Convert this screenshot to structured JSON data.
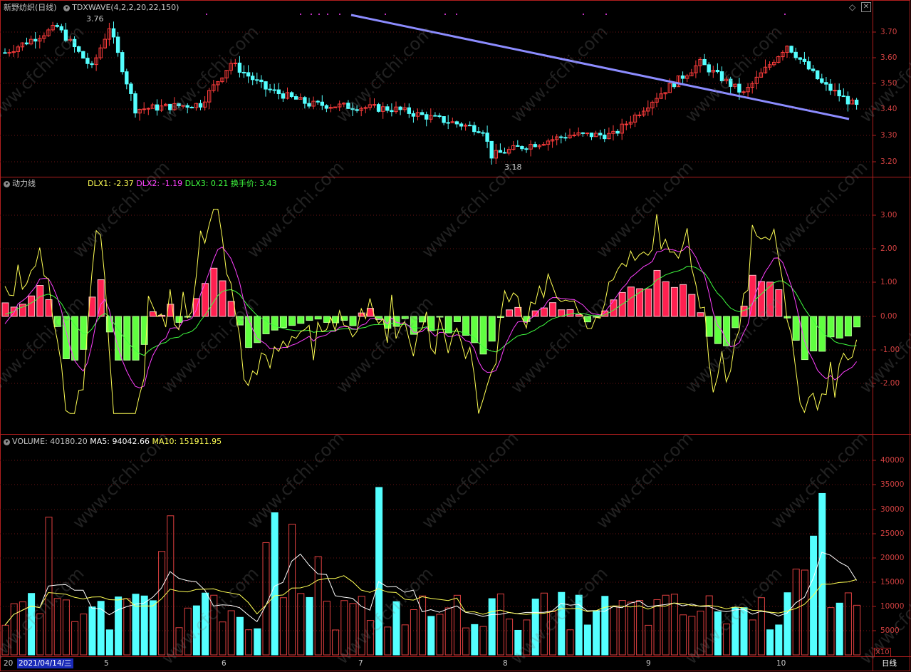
{
  "main": {
    "stock_name": "新野纺织",
    "period": "(日线)",
    "indicator": "TDXWAVE(4,2,2,20,22,150)",
    "high_label": "3.76",
    "low_label": "3.18",
    "yaxis": [
      "3.70",
      "3.60",
      "3.50",
      "3.40",
      "3.30",
      "3.20"
    ]
  },
  "dl": {
    "name": "动力线",
    "dlx1": "DLX1: -2.37",
    "dlx2": "DLX2: -1.19",
    "dlx3": "DLX3: 0.21",
    "hsj": "换手价: 3.43",
    "yaxis": [
      "3.00",
      "2.00",
      "1.00",
      "0.00",
      "-1.00",
      "-2.00"
    ]
  },
  "vol": {
    "volume": "VOLUME: 40180.20",
    "ma5": "MA5: 94042.66",
    "ma10": "MA10: 151911.95",
    "yaxis": [
      "40000",
      "35000",
      "30000",
      "25000",
      "20000",
      "15000",
      "10000",
      "5000"
    ],
    "unit": "X10"
  },
  "xaxis": {
    "prefix": "20",
    "cursor_date": "2021/04/14/三",
    "months": [
      "5",
      "6",
      "7",
      "8",
      "9",
      "10"
    ],
    "period_button": "日线"
  },
  "watermark": "www.cfchi.com",
  "colors": {
    "up": "#ff3c3c",
    "down": "#54ffff",
    "frame": "#b01e1e",
    "trend": "#8c8cff",
    "dlx1": "#ffff54",
    "dlx2": "#ff40ff",
    "dlx3": "#40ff40",
    "ma5": "#ffffff",
    "ma10": "#ffff54"
  },
  "icons": [
    "collapse-icon",
    "diamond-icon",
    "window-close-icon"
  ]
}
